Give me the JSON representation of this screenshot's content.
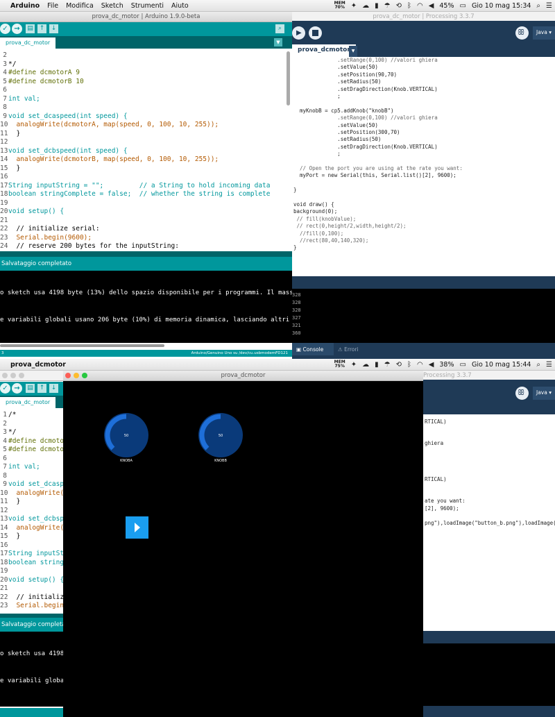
{
  "top": {
    "menubar": {
      "app": "Arduino",
      "items": [
        "File",
        "Modifica",
        "Sketch",
        "Strumenti",
        "Aiuto"
      ],
      "mem_label": "MEM",
      "mem_value": "70%",
      "battery": "45%",
      "datetime": "Gio 10 mag  15:34"
    },
    "arduino": {
      "title": "prova_dc_motor | Arduino 1.9.0-beta",
      "tab": "prova_dc_motor",
      "code": [
        {
          "n": "2",
          "t": ""
        },
        {
          "n": "3",
          "t": "*/"
        },
        {
          "n": "4",
          "t": "#define dcmotorA 9"
        },
        {
          "n": "5",
          "t": "#define dcmotorB 10"
        },
        {
          "n": "6",
          "t": ""
        },
        {
          "n": "7",
          "t": "int val;"
        },
        {
          "n": "8",
          "t": ""
        },
        {
          "n": "9",
          "t": "void set_dcaspeed(int speed) {"
        },
        {
          "n": "10",
          "t": "  analogWrite(dcmotorA, map(speed, 0, 100, 10, 255));"
        },
        {
          "n": "11",
          "t": "  }"
        },
        {
          "n": "12",
          "t": ""
        },
        {
          "n": "13",
          "t": "void set_dcbspeed(int speed) {"
        },
        {
          "n": "14",
          "t": "  analogWrite(dcmotorB, map(speed, 0, 100, 10, 255));"
        },
        {
          "n": "15",
          "t": "  }"
        },
        {
          "n": "16",
          "t": ""
        },
        {
          "n": "17",
          "t": "String inputString = \"\";         // a String to hold incoming data"
        },
        {
          "n": "18",
          "t": "boolean stringComplete = false;  // whether the string is complete"
        },
        {
          "n": "19",
          "t": ""
        },
        {
          "n": "20",
          "t": "void setup() {"
        },
        {
          "n": "21",
          "t": ""
        },
        {
          "n": "22",
          "t": "  // initialize serial:"
        },
        {
          "n": "23",
          "t": "  Serial.begin(9600);"
        },
        {
          "n": "24",
          "t": "  // reserve 200 bytes for the inputString:"
        }
      ],
      "status": "Salvataggio completato",
      "console": [
        "o sketch usa 4198 byte (13%) dello spazio disponibile per i programmi. Il massimo",
        "e variabili globali usano 206 byte (10%) di memoria dinamica, lasciando altri 1842"
      ],
      "footer": "Arduino/Genuino Uno su /dev/cu.usbmodemFD121",
      "footer_left": "3"
    },
    "processing": {
      "title": "prova_dc_motor | Processing 3.3.7",
      "tab": "prova_dcmotor",
      "mode": "Java",
      "code": [
        "              .setRange(0,100) //valori ghiera",
        "              .setValue(50)",
        "              .setPosition(90,70)",
        "              .setRadius(50)",
        "              .setDragDirection(Knob.VERTICAL)",
        "              ;",
        "",
        "  myKnobB = cp5.addKnob(\"knobB\")",
        "              .setRange(0,100) //valori ghiera",
        "              .setValue(50)",
        "              .setPosition(300,70)",
        "              .setRadius(50)",
        "              .setDragDirection(Knob.VERTICAL)",
        "              ;",
        "",
        "  // Open the port you are using at the rate you want:",
        "  myPort = new Serial(this, Serial.list()[2], 9600);",
        "",
        "}",
        "",
        "void draw() {",
        "background(0);",
        " // fill(knobValue);",
        " // rect(0,height/2,width,height/2);",
        "  //fill(0,100);",
        "  //rect(80,40,140,320);",
        "}"
      ],
      "console": [
        "328",
        "328",
        "328",
        "327",
        "321",
        "360"
      ],
      "console_tab": "Console",
      "errors_tab": "Errori"
    }
  },
  "bottom": {
    "menubar": {
      "app": "prova_dcmotor",
      "mem_label": "MEM",
      "mem_value": "75%",
      "battery": "38%",
      "datetime": "Gio 10 mag  15:44"
    },
    "arduino": {
      "tab": "prova_dc_motor",
      "code": [
        {
          "n": "1",
          "t": "/*"
        },
        {
          "n": "2",
          "t": ""
        },
        {
          "n": "3",
          "t": "*/"
        },
        {
          "n": "4",
          "t": "#define dcmotor"
        },
        {
          "n": "5",
          "t": "#define dcmotor"
        },
        {
          "n": "6",
          "t": ""
        },
        {
          "n": "7",
          "t": "int val;"
        },
        {
          "n": "8",
          "t": ""
        },
        {
          "n": "9",
          "t": "void set_dcaspe"
        },
        {
          "n": "10",
          "t": "  analogWrite(d"
        },
        {
          "n": "11",
          "t": "  }"
        },
        {
          "n": "12",
          "t": ""
        },
        {
          "n": "13",
          "t": "void set_dcbspe"
        },
        {
          "n": "14",
          "t": "  analogWrite(d"
        },
        {
          "n": "15",
          "t": "  }"
        },
        {
          "n": "16",
          "t": ""
        },
        {
          "n": "17",
          "t": "String inputStr"
        },
        {
          "n": "18",
          "t": "boolean stringC"
        },
        {
          "n": "19",
          "t": ""
        },
        {
          "n": "20",
          "t": "void setup() {"
        },
        {
          "n": "21",
          "t": ""
        },
        {
          "n": "22",
          "t": "  // initialize"
        },
        {
          "n": "23",
          "t": "  Serial.begin("
        }
      ],
      "status": "Salvataggio completato",
      "console": [
        "o sketch usa 4198",
        "e variabili global"
      ]
    },
    "sketch": {
      "title": "prova_dcmotor",
      "knobA": {
        "label": "KNOBA",
        "value": "50",
        "level": 0.5
      },
      "knobB": {
        "label": "KNOBB",
        "value": "50",
        "level": 0.5
      },
      "play_icon": "play-icon"
    },
    "processing": {
      "title": "Processing 3.3.7",
      "mode": "Java",
      "code": [
        "RTICAL)",
        "",
        "",
        "ghiera",
        "",
        "",
        "",
        "",
        "RTICAL)",
        "",
        "",
        "ate you want:",
        "[2], 9600);",
        "",
        "png\"),loadImage(\"button_b.png\"),loadImage("
      ]
    }
  },
  "colors": {
    "arduino_teal": "#00979c",
    "arduino_dark": "#006468",
    "processing_navy": "#1f3a56",
    "knob_fill": "#0a3a7a",
    "knob_arc": "#1e6fd9",
    "play_button": "#1a9ef0"
  }
}
